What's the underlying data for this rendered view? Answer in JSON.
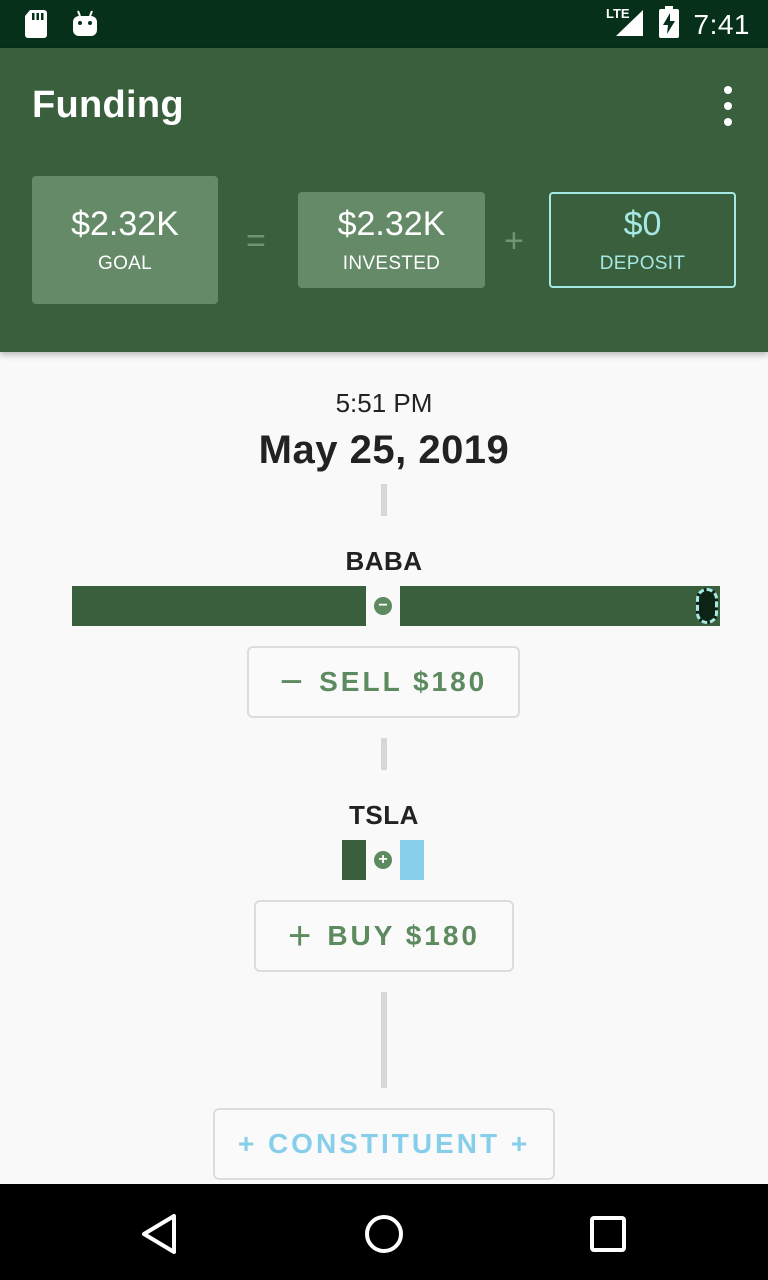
{
  "status_bar": {
    "network": "LTE",
    "time": "7:41",
    "icons": [
      "sd-card-icon",
      "android-icon",
      "signal-icon",
      "battery-charging-icon"
    ]
  },
  "app_bar": {
    "title": "Funding",
    "menu_icon": "more-vert-icon",
    "goal": {
      "amount": "$2.32K",
      "label": "GOAL"
    },
    "equals": "=",
    "invested": {
      "amount": "$2.32K",
      "label": "INVESTED"
    },
    "plus": "+",
    "deposit": {
      "amount": "$0",
      "label": "DEPOSIT"
    }
  },
  "timestamp": {
    "time": "5:51 PM",
    "date": "May 25, 2019"
  },
  "constituents": [
    {
      "ticker": "BABA",
      "action_icon": "−",
      "action_label": "SELL $180",
      "bar_icon": "minus-circle-icon"
    },
    {
      "ticker": "TSLA",
      "action_icon": "+",
      "action_label": "BUY $180",
      "bar_icon": "plus-circle-icon"
    }
  ],
  "add_constituent_label": "+ CONSTITUENT +",
  "colors": {
    "primary": "#3a5f3d",
    "primary_light": "#658a68",
    "accent": "#a6e8e3",
    "sky": "#87ceeb",
    "status_bar": "#06301a"
  },
  "nav_bar": [
    "back-icon",
    "home-icon",
    "recents-icon"
  ]
}
